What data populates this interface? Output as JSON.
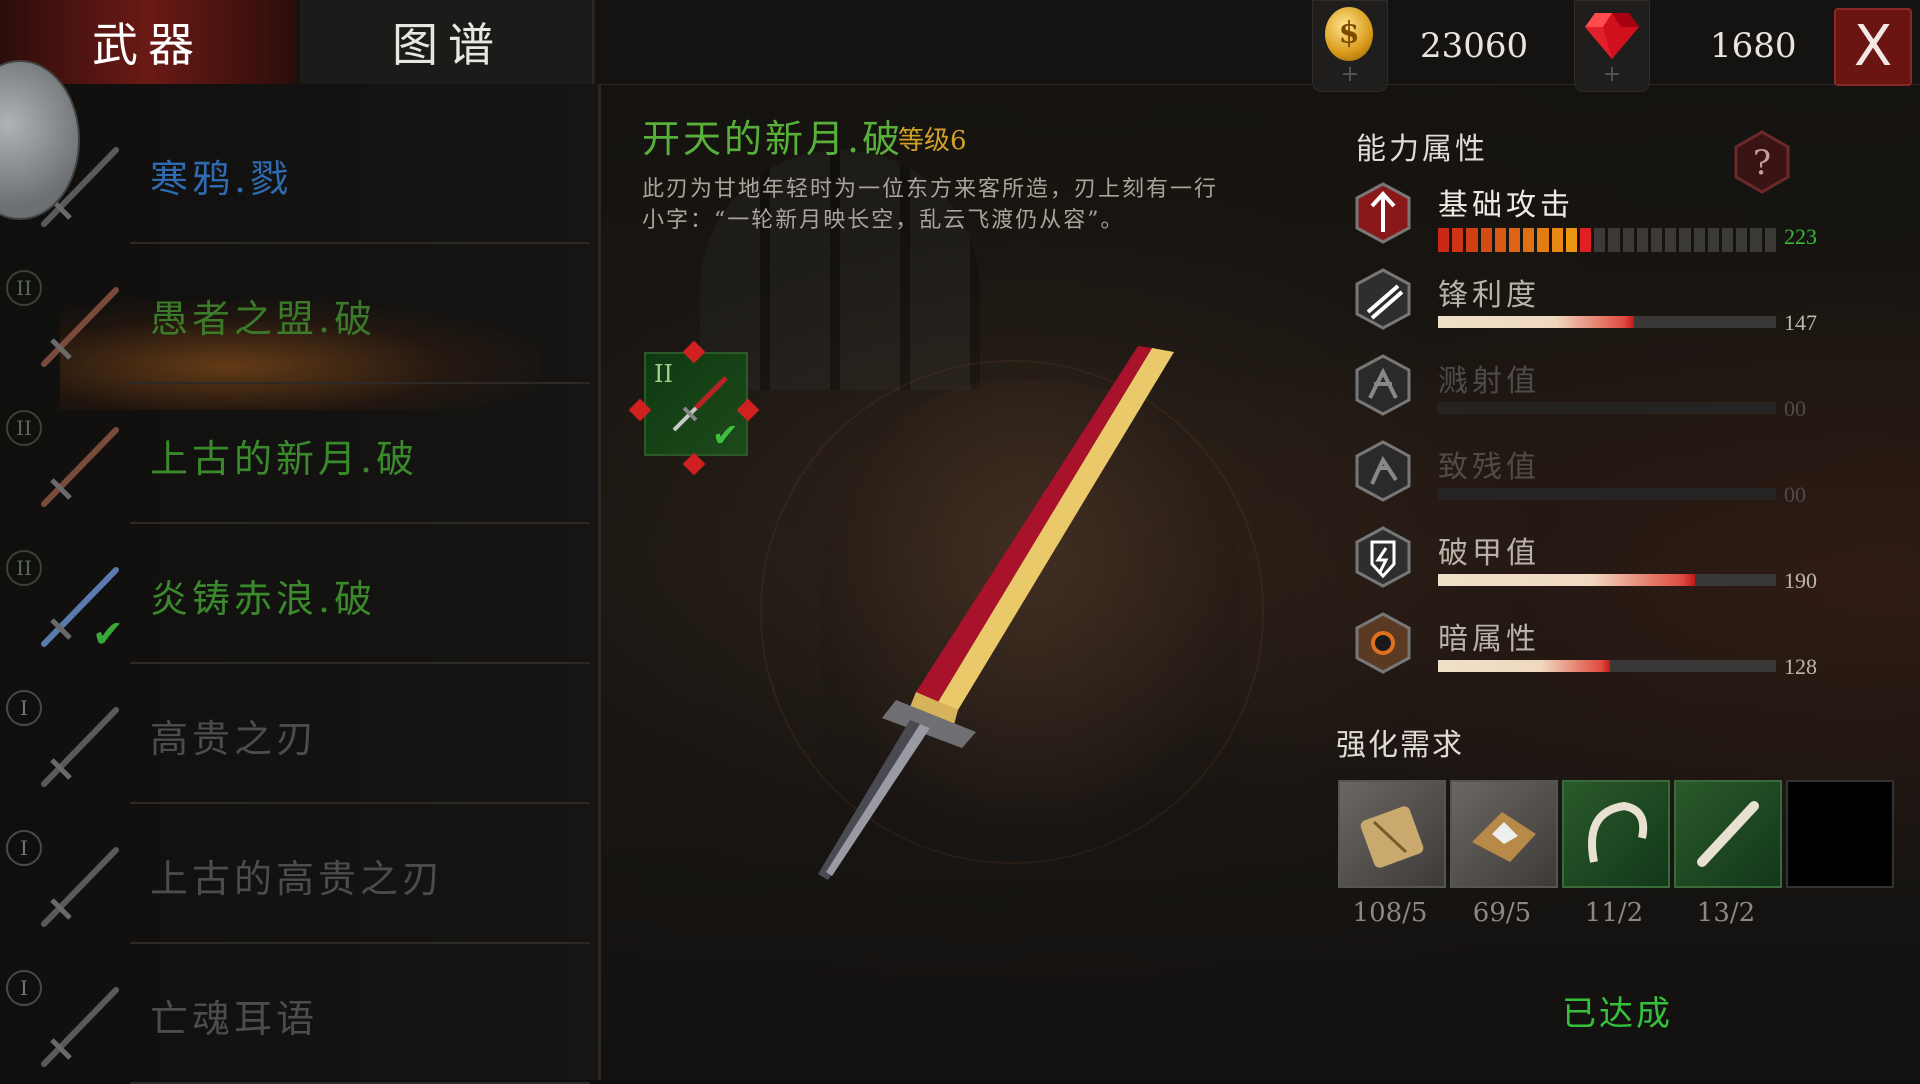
{
  "tabs": {
    "weapons": "武器",
    "codex": "图谱"
  },
  "currency": {
    "gold": "23060",
    "gems": "1680",
    "close": "X"
  },
  "weapon_list": [
    {
      "name": "寒鸦.戮",
      "tier": "",
      "color": "#2e6bb0"
    },
    {
      "name": "愚者之盟.破",
      "tier": "II",
      "color": "#3a7a28"
    },
    {
      "name": "上古的新月.破",
      "tier": "II",
      "color": "#3a8a2c"
    },
    {
      "name": "炎铸赤浪.破",
      "tier": "II",
      "color": "#3a8a2c"
    },
    {
      "name": "高贵之刃",
      "tier": "I",
      "color": "#4c4c4c"
    },
    {
      "name": "上古的高贵之刃",
      "tier": "I",
      "color": "#4c4c4c"
    },
    {
      "name": "亡魂耳语",
      "tier": "I",
      "color": "#4c4c4c"
    }
  ],
  "detail": {
    "title": "开天的新月.破",
    "level": "等级6",
    "description": "此刃为甘地年轻时为一位东方来客所造，刃上刻有一行小字：“一轮新月映长空，乱云飞渡仍从容”。",
    "slot_tier": "II"
  },
  "attributes": {
    "title": "能力属性",
    "stats": [
      {
        "name": "基础攻击",
        "value": "223",
        "level": 0.45,
        "active": true
      },
      {
        "name": "锋利度",
        "value": "147",
        "level": 0.58,
        "active": true
      },
      {
        "name": "溅射值",
        "value": "00",
        "level": 0,
        "active": false
      },
      {
        "name": "致残值",
        "value": "00",
        "level": 0,
        "active": false
      },
      {
        "name": "破甲值",
        "value": "190",
        "level": 0.76,
        "active": true
      },
      {
        "name": "暗属性",
        "value": "128",
        "level": 0.51,
        "active": true
      }
    ]
  },
  "requirements": {
    "title": "强化需求",
    "materials": [
      {
        "icon": "wood-plank-icon",
        "count": "108/5",
        "style": "gray"
      },
      {
        "icon": "ore-chunk-icon",
        "count": "69/5",
        "style": "gray"
      },
      {
        "icon": "claw-icon",
        "count": "11/2",
        "style": "green"
      },
      {
        "icon": "bone-icon",
        "count": "13/2",
        "style": "green"
      },
      {
        "icon": "empty-slot",
        "count": "",
        "style": "empty"
      }
    ],
    "status": "已达成"
  },
  "colors": {
    "green": "#35c23a",
    "gold": "#d0a028",
    "red_accent": "#c01818"
  }
}
